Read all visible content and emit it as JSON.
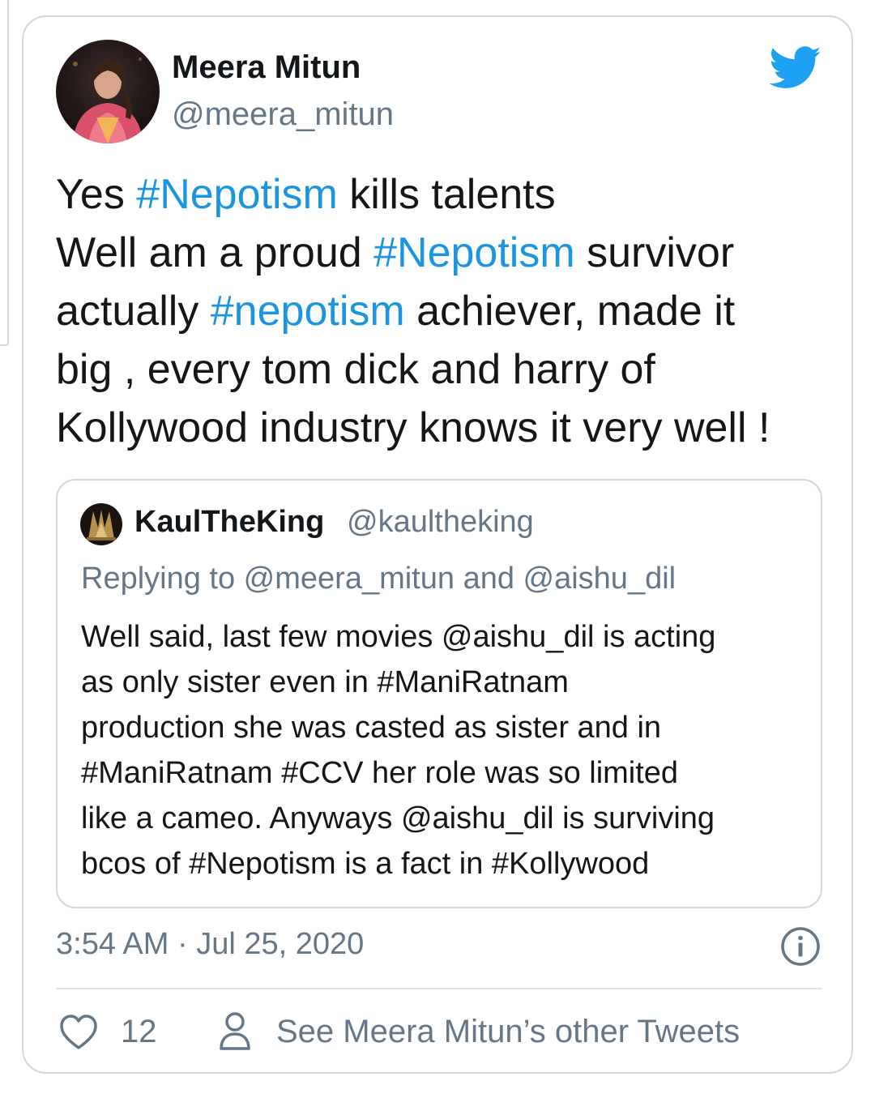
{
  "tweet": {
    "author_name": "Meera Mitun",
    "author_handle": "@meera_mitun",
    "text_lines": [
      [
        {
          "t": "Yes ",
          "tag": false
        },
        {
          "t": "#Nepotism",
          "tag": true
        },
        {
          "t": " kills talents",
          "tag": false
        }
      ],
      [
        {
          "t": "Well am a proud ",
          "tag": false
        },
        {
          "t": "#Nepotism",
          "tag": true
        },
        {
          "t": " survivor",
          "tag": false
        }
      ],
      [
        {
          "t": "actually ",
          "tag": false
        },
        {
          "t": "#nepotism",
          "tag": true
        },
        {
          "t": " achiever, made it",
          "tag": false
        }
      ],
      [
        {
          "t": "big , every tom dick and harry of",
          "tag": false
        }
      ],
      [
        {
          "t": "Kollywood industry knows it very well !",
          "tag": false
        }
      ]
    ],
    "timestamp": "3:54 AM · Jul 25, 2020",
    "like_count": "12",
    "other_tweets_label": "See Meera Mitun’s other Tweets"
  },
  "quoted_tweet": {
    "author_name": "KaulTheKing",
    "author_handle": "@kaultheking",
    "replying_to": "Replying to @meera_mitun and @aishu_dil",
    "text_lines": [
      "Well said, last few movies @aishu_dil is acting",
      "as only sister even in #ManiRatnam",
      "production she was casted as sister and in",
      "#ManiRatnam #CCV her role was so limited",
      "like a cameo. Anyways @aishu_dil is surviving",
      "bcos of #Nepotism is a fact in #Kollywood"
    ]
  },
  "icons": {
    "logo": "twitter-bird-icon",
    "info": "info-icon",
    "like": "heart-icon",
    "profile": "person-icon"
  },
  "colors": {
    "brand": "#1da1f2",
    "hashtag": "#1b95e0",
    "secondary_text": "#657786",
    "border": "#cfd9de"
  }
}
